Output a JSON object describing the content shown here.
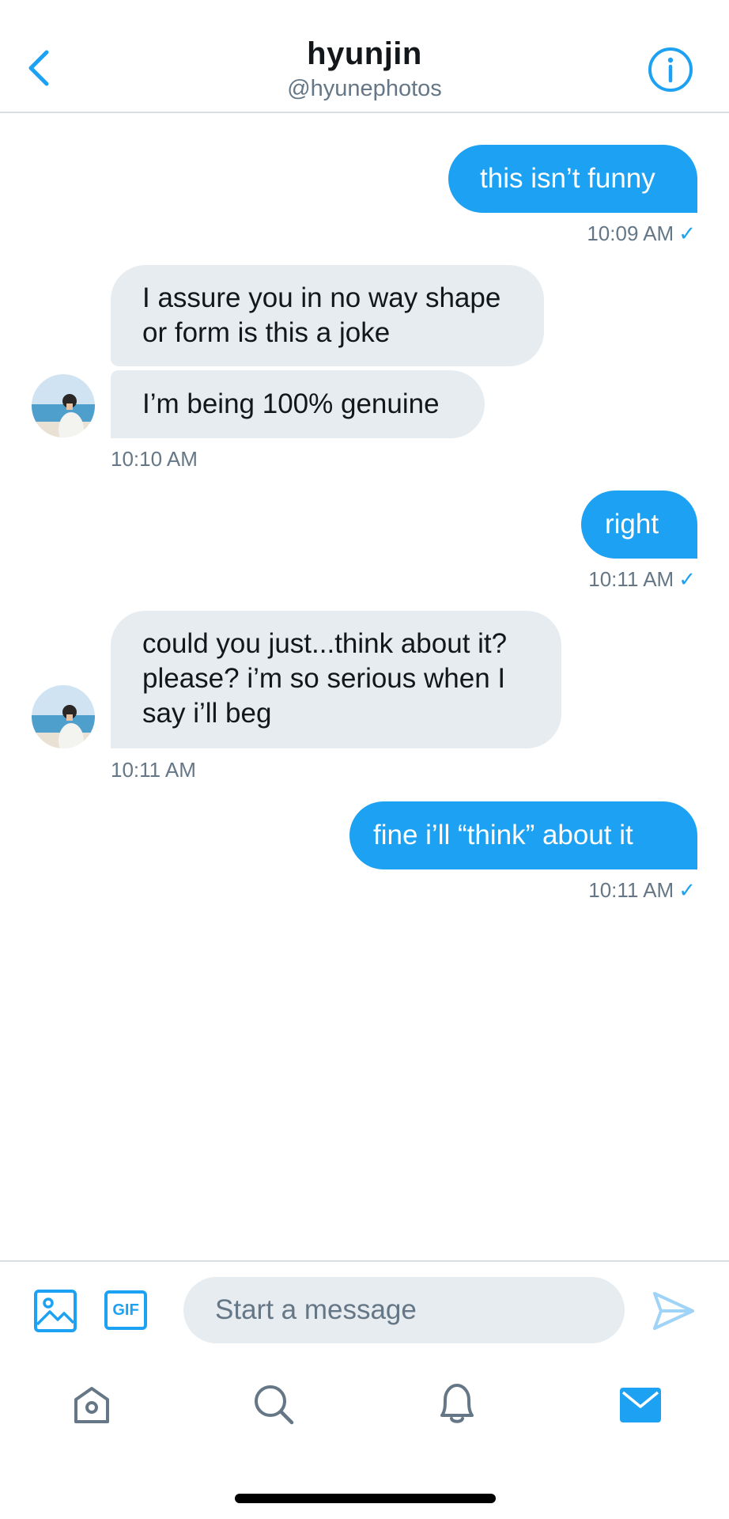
{
  "header": {
    "title": "hyunjin",
    "handle": "@hyunephotos",
    "back_icon": "chevron-left-icon",
    "info_icon": "info-circle-icon"
  },
  "messages": [
    {
      "direction": "sent",
      "texts": [
        "this isn’t funny"
      ],
      "time": "10:09 AM",
      "read_check": "✓"
    },
    {
      "direction": "received",
      "texts": [
        "I assure you in no way shape or form is this a joke",
        "I’m being 100% genuine"
      ],
      "time": "10:10 AM"
    },
    {
      "direction": "sent",
      "texts": [
        "right"
      ],
      "time": "10:11 AM",
      "read_check": "✓"
    },
    {
      "direction": "received",
      "texts": [
        "could you just...think about it? please? i’m so serious when I say i’ll beg"
      ],
      "time": "10:11 AM"
    },
    {
      "direction": "sent",
      "texts": [
        "fine i’ll “think” about it"
      ],
      "time": "10:11 AM",
      "read_check": "✓"
    }
  ],
  "composer": {
    "placeholder": "Start a message",
    "gif_label": "GIF",
    "image_icon": "image-icon",
    "send_icon": "send-icon"
  },
  "tabbar": {
    "items": [
      "home-icon",
      "search-icon",
      "notifications-icon",
      "messages-icon"
    ],
    "active": "messages-icon"
  },
  "colors": {
    "accent": "#1da1f2",
    "received_bubble": "#e6ecf0",
    "secondary_text": "#657786"
  }
}
